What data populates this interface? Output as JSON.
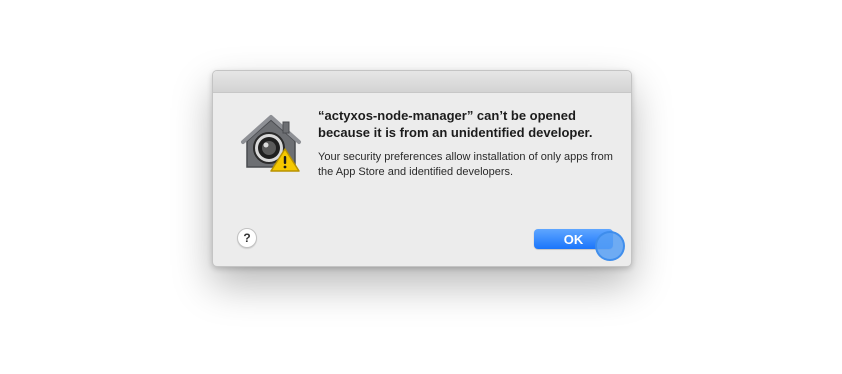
{
  "dialog": {
    "heading": "“actyxos-node-manager” can’t be opened because it is from an unidentified developer.",
    "message": "Your security preferences allow installation of only apps from the App Store and identified developers.",
    "icon": "gatekeeper-warning-icon",
    "help_label": "?",
    "ok_label": "OK"
  },
  "colors": {
    "accent": "#1a75fb",
    "dialog_bg": "#ececec",
    "warning_yellow": "#f5c800"
  }
}
